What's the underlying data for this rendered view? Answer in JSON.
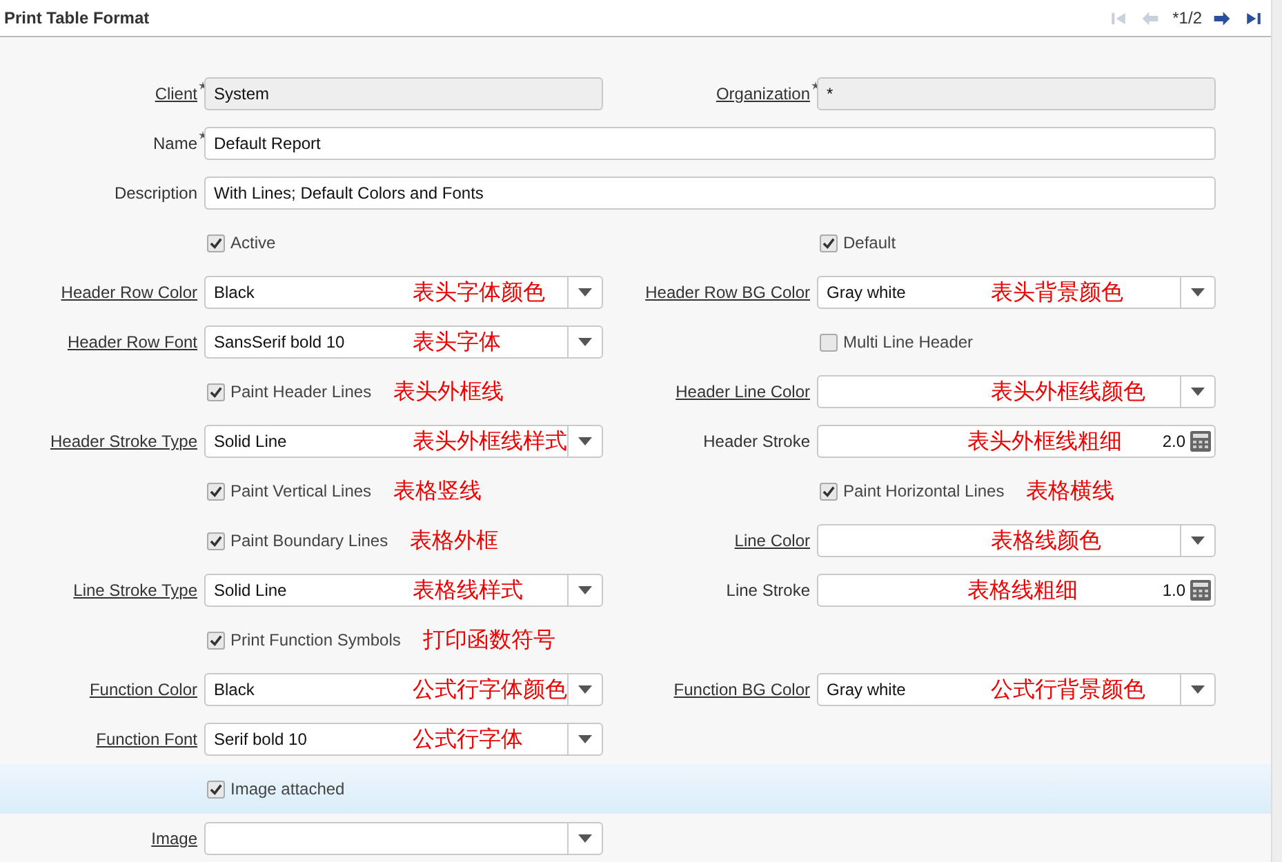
{
  "header": {
    "title": "Print Table Format",
    "record": "*1/2",
    "nav": [
      {
        "kind": "first",
        "disabled": true
      },
      {
        "kind": "prev",
        "disabled": true
      },
      {
        "kind": "next",
        "disabled": false
      },
      {
        "kind": "last",
        "disabled": false
      }
    ]
  },
  "rows": [
    {
      "highlighted": false,
      "cells": [
        {
          "kind": "text",
          "label": "Client",
          "link": true,
          "required": true,
          "readonly": true,
          "value": "System"
        },
        {
          "kind": "text",
          "label": "Organization",
          "link": true,
          "required": true,
          "readonly": true,
          "value": "*"
        }
      ]
    },
    {
      "highlighted": false,
      "cells": [
        {
          "kind": "text",
          "wide": true,
          "label": "Name",
          "link": false,
          "required": true,
          "readonly": false,
          "value": "Default Report"
        }
      ]
    },
    {
      "highlighted": false,
      "cells": [
        {
          "kind": "text",
          "wide": true,
          "label": "Description",
          "link": false,
          "readonly": false,
          "value": "With Lines; Default Colors and Fonts"
        }
      ]
    },
    {
      "highlighted": false,
      "cells": [
        {
          "kind": "checkbox",
          "label": "Active",
          "checked": true
        },
        {
          "kind": "checkbox",
          "label": "Default",
          "checked": true
        }
      ]
    },
    {
      "highlighted": false,
      "cells": [
        {
          "kind": "select",
          "label": "Header Row Color",
          "link": true,
          "value": "Black",
          "annotation": "表头字体颜色"
        },
        {
          "kind": "select",
          "label": "Header Row BG Color",
          "link": true,
          "value": "Gray white",
          "annotation": "表头背景颜色"
        }
      ]
    },
    {
      "highlighted": false,
      "cells": [
        {
          "kind": "select",
          "label": "Header Row Font",
          "link": true,
          "value": "SansSerif bold 10",
          "annotation": "表头字体"
        },
        {
          "kind": "checkbox",
          "label": "Multi Line Header",
          "checked": false
        }
      ]
    },
    {
      "highlighted": false,
      "cells": [
        {
          "kind": "checkbox",
          "label": "Paint Header Lines",
          "checked": true,
          "annotation": "表头外框线"
        },
        {
          "kind": "select",
          "label": "Header Line Color",
          "link": true,
          "annotation": "表头外框线颜色"
        }
      ]
    },
    {
      "highlighted": false,
      "cells": [
        {
          "kind": "select",
          "label": "Header Stroke Type",
          "link": true,
          "value": "Solid Line",
          "annotation": "表头外框线样式"
        },
        {
          "kind": "number",
          "label": "Header Stroke",
          "link": false,
          "value": "2.0",
          "annotation": "表头外框线粗细"
        }
      ]
    },
    {
      "highlighted": false,
      "cells": [
        {
          "kind": "checkbox",
          "label": "Paint Vertical Lines",
          "checked": true,
          "annotation": "表格竖线"
        },
        {
          "kind": "checkbox",
          "label": "Paint Horizontal Lines",
          "checked": true,
          "annotation": "表格横线"
        }
      ]
    },
    {
      "highlighted": false,
      "cells": [
        {
          "kind": "checkbox",
          "label": "Paint Boundary Lines",
          "checked": true,
          "annotation": "表格外框"
        },
        {
          "kind": "select",
          "label": "Line Color",
          "link": true,
          "annotation": "表格线颜色"
        }
      ]
    },
    {
      "highlighted": false,
      "cells": [
        {
          "kind": "select",
          "label": "Line Stroke Type",
          "link": true,
          "value": "Solid Line",
          "annotation": "表格线样式"
        },
        {
          "kind": "number",
          "label": "Line Stroke",
          "link": false,
          "value": "1.0",
          "annotation": "表格线粗细"
        }
      ]
    },
    {
      "highlighted": false,
      "cells": [
        {
          "kind": "checkbox",
          "label": "Print Function Symbols",
          "checked": true,
          "annotation": "打印函数符号"
        }
      ]
    },
    {
      "highlighted": false,
      "cells": [
        {
          "kind": "select",
          "label": "Function Color",
          "link": true,
          "value": "Black",
          "annotation": "公式行字体颜色"
        },
        {
          "kind": "select",
          "label": "Function BG Color",
          "link": true,
          "value": "Gray white",
          "annotation": "公式行背景颜色"
        }
      ]
    },
    {
      "highlighted": false,
      "cells": [
        {
          "kind": "select",
          "label": "Function Font",
          "link": true,
          "value": "Serif bold 10",
          "annotation": "公式行字体"
        }
      ]
    },
    {
      "highlighted": true,
      "cells": [
        {
          "kind": "checkbox",
          "label": "Image attached",
          "checked": true
        }
      ]
    },
    {
      "highlighted": false,
      "cells": [
        {
          "kind": "select",
          "label": "Image",
          "link": true
        }
      ]
    }
  ]
}
